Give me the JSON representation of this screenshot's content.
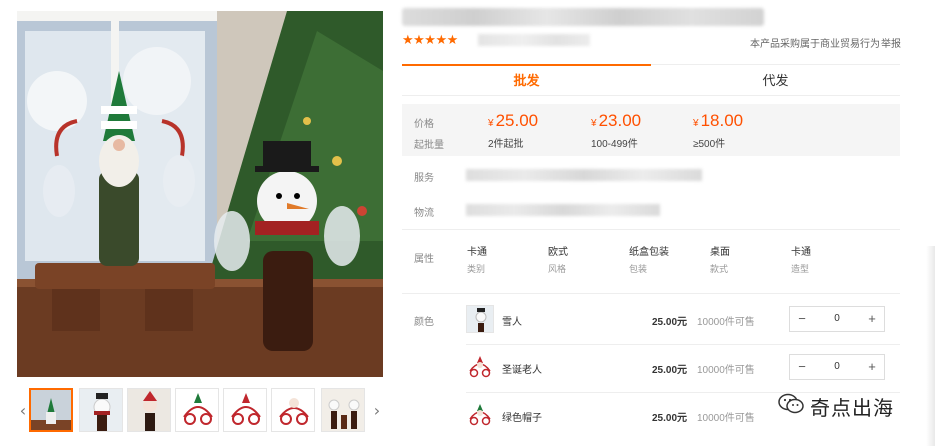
{
  "gallery": {
    "main_image": "snowman-gnome-wine-glass-holder-photo",
    "thumbnails": [
      "gnome-bottle-holder-thumb",
      "snowman-bottle-holder-thumb",
      "santa-bottle-holder-thumb",
      "green-hat-reindeer-holder-thumb",
      "red-hat-reindeer-holder-thumb",
      "reindeer-holder-thumb",
      "snowman-set-thumb"
    ],
    "prev_arrow": "‹",
    "next_arrow": "›"
  },
  "header": {
    "stars": "★★★★★",
    "trade_note": "本产品采购属于商业贸易行为",
    "report_label": "举报"
  },
  "tabs": [
    {
      "label": "批发",
      "active": true
    },
    {
      "label": "代发",
      "active": false
    }
  ],
  "pricing": {
    "price_label": "价格",
    "moq_label": "起批量",
    "currency": "¥",
    "tiers": [
      {
        "price": "25.00",
        "qty": "2件起批"
      },
      {
        "price": "23.00",
        "qty": "100-499件"
      },
      {
        "price": "18.00",
        "qty": "≥500件"
      }
    ]
  },
  "service": {
    "label": "服务"
  },
  "logistics": {
    "label": "物流"
  },
  "attributes": {
    "label": "属性",
    "items": [
      {
        "value": "卡通",
        "key": "类别"
      },
      {
        "value": "欧式",
        "key": "风格"
      },
      {
        "value": "纸盒包装",
        "key": "包装"
      },
      {
        "value": "桌面",
        "key": "款式"
      },
      {
        "value": "卡通",
        "key": "造型"
      }
    ]
  },
  "color": {
    "label": "颜色",
    "skus": [
      {
        "name": "雪人",
        "price": "25.00元",
        "stock": "10000件可售",
        "qty": "0",
        "thumb": "snowman-sku-thumb"
      },
      {
        "name": "圣诞老人",
        "price": "25.00元",
        "stock": "10000件可售",
        "qty": "0",
        "thumb": "santa-sku-thumb"
      },
      {
        "name": "绿色帽子",
        "price": "25.00元",
        "stock": "10000件可售",
        "qty": "0",
        "thumb": "green-hat-sku-thumb"
      }
    ]
  },
  "stepper": {
    "minus": "−",
    "plus": "+"
  },
  "watermark": {
    "text": "奇点出海",
    "icon": "wechat-icon"
  },
  "colors": {
    "accent": "#ff6a00",
    "price": "#ff5000"
  }
}
